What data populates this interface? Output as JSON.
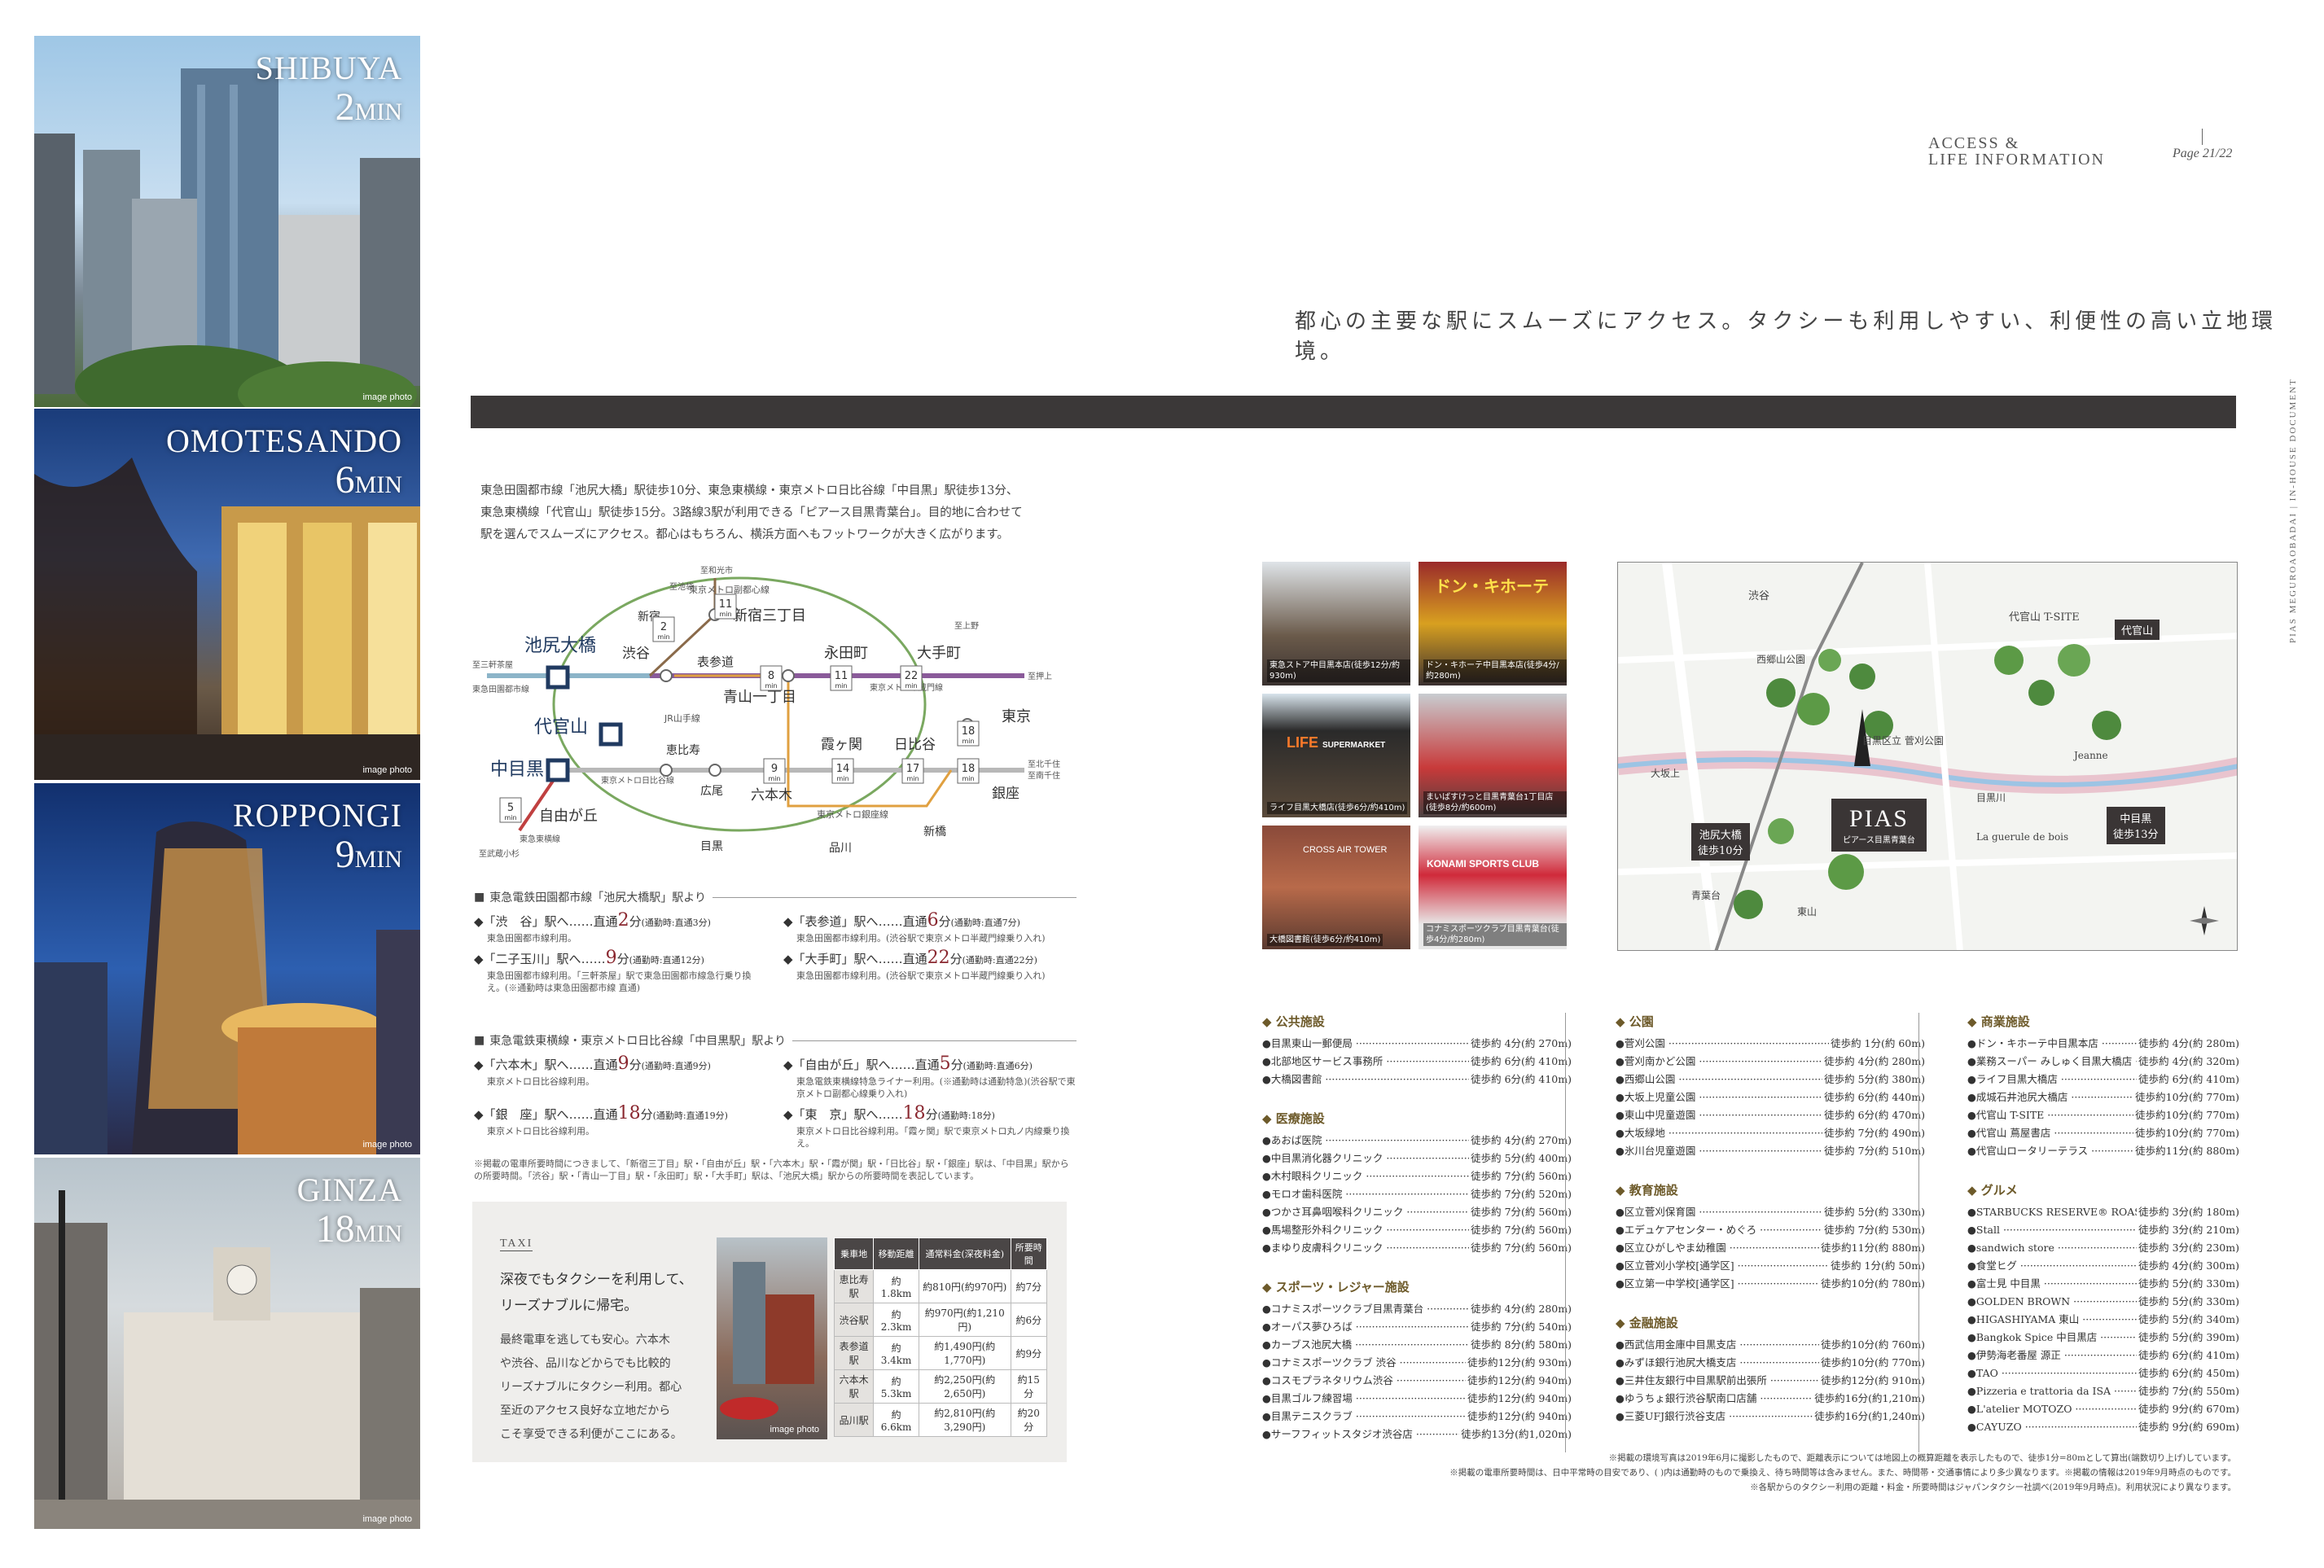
{
  "photos": [
    {
      "name": "SHIBUYA",
      "time": "2",
      "unit": "MIN",
      "note": "image photo"
    },
    {
      "name": "OMOTESANDO",
      "time": "6",
      "unit": "MIN",
      "note": "image photo"
    },
    {
      "name": "ROPPONGI",
      "time": "9",
      "unit": "MIN",
      "note": "image photo"
    },
    {
      "name": "GINZA",
      "time": "18",
      "unit": "MIN",
      "note": "image photo"
    }
  ],
  "header": {
    "line1": "ACCESS &",
    "line2": "LIFE INFORMATION",
    "page": "Page 21/22",
    "side": "PIAS MEGUROAOBADAI | IN-HOUSE DOCUMENT"
  },
  "tagline": "都心の主要な駅にスムーズにアクセス。タクシーも利用しやすい、利便性の高い立地環境。",
  "intro": [
    "東急田園都市線「池尻大橋」駅徒歩10分、東急東横線・東京メトロ日比谷線「中目黒」駅徒歩13分、",
    "東急東横線「代官山」駅徒歩15分。3路線3駅が利用できる「ピアース目黒青葉台」。目的地に合わせて",
    "駅を選んでスムーズにアクセス。都心はもちろん、横浜方面へもフットワークが大きく広がります。"
  ],
  "routemap": {
    "stations": {
      "ikejiri": "池尻大橋",
      "daikanyama": "代官山",
      "nakameguro": "中目黒",
      "shibuya": "渋谷",
      "shinjuku": "新宿",
      "shinjuku3": "新宿三丁目",
      "omotesando": "表参道",
      "aoyama1": "青山一丁目",
      "nagatacho": "永田町",
      "otemachi": "大手町",
      "tokyo": "東京",
      "kasumigaseki": "霞ヶ関",
      "hibiya": "日比谷",
      "ginza": "銀座",
      "roppongi": "六本木",
      "ebisu": "恵比寿",
      "hiroo": "広尾",
      "meguro": "目黒",
      "shinagawa": "品川",
      "shimbashi": "新橋",
      "jiyugaoka": "自由が丘"
    },
    "lines": {
      "denentoshi": "東急田園都市線",
      "fukutoshin": "東京メトロ副都心線",
      "yamanote": "JR山手線",
      "hibiya": "東京メトロ日比谷線",
      "ginzaline": "東京メトロ銀座線",
      "hanzomon": "東京メトロ半蔵門線",
      "toyoko": "東急東横線"
    },
    "mins": [
      "2",
      "11",
      "8",
      "11",
      "22",
      "18",
      "9",
      "14",
      "17",
      "18",
      "5"
    ],
    "min": "min",
    "ends": {
      "sangenjaya": "至三軒茶屋",
      "wako": "至和光市",
      "ikebukuro": "至池袋",
      "oshiage": "至押上",
      "ueno": "至上野",
      "kitasenju": "至北千住",
      "minowa": "至南千住",
      "musashikosugi": "至武蔵小杉"
    }
  },
  "routes1": {
    "title": "東急電鉄田園都市線「池尻大橋駅」駅より",
    "items": [
      {
        "dest": "「渋　谷」駅へ",
        "dots": "……直通",
        "min": "2",
        "unit": "分",
        "note": "(通勤時:直通3分)",
        "sub": "東急田園都市線利用。"
      },
      {
        "dest": "「表参道」駅へ",
        "dots": "……直通",
        "min": "6",
        "unit": "分",
        "note": "(通勤時:直通7分)",
        "sub": "東急田園都市線利用。(渋谷駅で東京メトロ半蔵門線乗り入れ)"
      },
      {
        "dest": "「二子玉川」駅へ",
        "dots": "……",
        "min": "9",
        "unit": "分",
        "note": "(通勤時:直通12分)",
        "sub": "東急田園都市線利用。「三軒茶屋」駅で東急田園都市線急行乗り換え。(※通勤時は東急田園都市線 直通)"
      },
      {
        "dest": "「大手町」駅へ",
        "dots": "……直通",
        "min": "22",
        "unit": "分",
        "note": "(通勤時:直通22分)",
        "sub": "東急田園都市線利用。(渋谷駅で東京メトロ半蔵門線乗り入れ)"
      }
    ]
  },
  "routes2": {
    "title": "東急電鉄東横線・東京メトロ日比谷線「中目黒駅」駅より",
    "items": [
      {
        "dest": "「六本木」駅へ",
        "dots": "……直通",
        "min": "9",
        "unit": "分",
        "note": "(通勤時:直通9分)",
        "sub": "東京メトロ日比谷線利用。"
      },
      {
        "dest": "「自由が丘」駅へ",
        "dots": "……直通",
        "min": "5",
        "unit": "分",
        "note": "(通勤時:直通6分)",
        "sub": "東急電鉄東横線特急ライナー利用。(※通勤時は通勤特急)(渋谷駅で東京メトロ副都心線乗り入れ)"
      },
      {
        "dest": "「銀　座」駅へ",
        "dots": "……直通",
        "min": "18",
        "unit": "分",
        "note": "(通勤時:直通19分)",
        "sub": "東京メトロ日比谷線利用。"
      },
      {
        "dest": "「東　京」駅へ",
        "dots": "……",
        "min": "18",
        "unit": "分",
        "note": "(通勤時:18分)",
        "sub": "東京メトロ日比谷線利用。「霞ヶ関」駅で東京メトロ丸ノ内線乗り換え。"
      }
    ]
  },
  "route_note": "※掲載の電車所要時間につきまして、「新宿三丁目」駅・「自由が丘」駅・「六本木」駅・「霞が関」駅・「日比谷」駅・「銀座」駅は、「中目黒」駅からの所要時間。「渋谷」駅・「青山一丁目」駅・「永田町」駅・「大手町」駅は、「池尻大橋」駅からの所要時間を表記しています。",
  "taxi": {
    "label": "TAXI",
    "heading": [
      "深夜でもタクシーを利用して、",
      "リーズナブルに帰宅。"
    ],
    "body": [
      "最終電車を逃しても安心。六本木",
      "や渋谷、品川などからでも比較的",
      "リーズナブルにタクシー利用。都心",
      "至近のアクセス良好な立地だから",
      "こそ享受できる利便がここにある。"
    ],
    "photo_note": "image photo",
    "table": {
      "headers": [
        "乗車地",
        "移動距離",
        "通常料金(深夜料金)",
        "所要時間"
      ],
      "rows": [
        [
          "恵比寿駅",
          "約1.8km",
          "約810円(約970円)",
          "約7分"
        ],
        [
          "渋谷駅",
          "約2.3km",
          "約970円(約1,210円)",
          "約6分"
        ],
        [
          "表参道駅",
          "約3.4km",
          "約1,490円(約1,770円)",
          "約9分"
        ],
        [
          "六本木駅",
          "約5.3km",
          "約2,250円(約2,650円)",
          "約15分"
        ],
        [
          "品川駅",
          "約6.6km",
          "約2,810円(約3,290円)",
          "約20分"
        ]
      ]
    }
  },
  "thumbs": [
    {
      "cap": "東急ストア中目黒本店(徒歩12分/約930m)"
    },
    {
      "cap": "ドン・キホーテ中目黒本店(徒歩4分/約280m)"
    },
    {
      "cap": "ライフ目黒大橋店(徒歩6分/約410m)"
    },
    {
      "cap": "まいばすけっと目黒青葉台1丁目店(徒歩8分/約600m)"
    },
    {
      "cap": "大橋図書館(徒歩6分/約410m)"
    },
    {
      "cap": "コナミスポーツクラブ目黒青葉台(徒歩4分/約280m)"
    }
  ],
  "thumb_signs": {
    "life": "LIFE",
    "life_sub": "SUPERMARKET",
    "crossair": "CROSS AIR TOWER",
    "konami": "KONAMI SPORTS CLUB",
    "donki": "ドン・キホーテ"
  },
  "map": {
    "pias": "PIAS",
    "pias_sub": "ピアース目黒青葉台",
    "ikejiri": "池尻大橋",
    "ikejiri_walk": "徒歩10分",
    "nakameguro": "中目黒",
    "nakameguro_walk": "徒歩13分",
    "daikanyama": "代官山",
    "labels": [
      "渋谷",
      "代官山 T-SITE",
      "目黒区立 菅刈公園",
      "Jeanne",
      "西郷山公園",
      "大坂上",
      "目黒川",
      "La guerule de bois",
      "東山",
      "青葉台"
    ]
  },
  "facilities": {
    "col1": [
      {
        "cat": "公共施設",
        "items": [
          [
            "目黒東山一郵便局",
            "徒歩約 4分(約 270m)"
          ],
          [
            "北部地区サービス事務所",
            "徒歩約 6分(約 410m)"
          ],
          [
            "大橋図書館",
            "徒歩約 6分(約 410m)"
          ]
        ]
      },
      {
        "cat": "医療施設",
        "items": [
          [
            "あおば医院",
            "徒歩約 4分(約 270m)"
          ],
          [
            "中目黒消化器クリニック",
            "徒歩約 5分(約 400m)"
          ],
          [
            "木村眼科クリニック",
            "徒歩約 7分(約 560m)"
          ],
          [
            "モロオ歯科医院",
            "徒歩約 7分(約 520m)"
          ],
          [
            "つかさ耳鼻咽喉科クリニック",
            "徒歩約 7分(約 560m)"
          ],
          [
            "馬場整形外科クリニック",
            "徒歩約 7分(約 560m)"
          ],
          [
            "まゆり皮膚科クリニック",
            "徒歩約 7分(約 560m)"
          ]
        ]
      },
      {
        "cat": "スポーツ・レジャー施設",
        "items": [
          [
            "コナミスポーツクラブ目黒青葉台",
            "徒歩約 4分(約 280m)"
          ],
          [
            "オーパス夢ひろば",
            "徒歩約 7分(約 540m)"
          ],
          [
            "カーブス池尻大橋",
            "徒歩約 8分(約 580m)"
          ],
          [
            "コナミスポーツクラブ 渋谷",
            "徒歩約12分(約 930m)"
          ],
          [
            "コスモプラネタリウム渋谷",
            "徒歩約12分(約 940m)"
          ],
          [
            "目黒ゴルフ練習場",
            "徒歩約12分(約 940m)"
          ],
          [
            "目黒テニスクラブ",
            "徒歩約12分(約 940m)"
          ],
          [
            "サーフフィットスタジオ渋谷店",
            "徒歩約13分(約1,020m)"
          ]
        ]
      }
    ],
    "col2": [
      {
        "cat": "公園",
        "items": [
          [
            "菅刈公園",
            "徒歩約 1分(約  60m)"
          ],
          [
            "菅刈南かど公園",
            "徒歩約 4分(約 280m)"
          ],
          [
            "西郷山公園",
            "徒歩約 5分(約 380m)"
          ],
          [
            "大坂上児童公園",
            "徒歩約 6分(約 440m)"
          ],
          [
            "東山中児童遊園",
            "徒歩約 6分(約 470m)"
          ],
          [
            "大坂緑地",
            "徒歩約 7分(約 490m)"
          ],
          [
            "氷川台児童遊園",
            "徒歩約 7分(約 510m)"
          ]
        ]
      },
      {
        "cat": "教育施設",
        "items": [
          [
            "区立菅刈保育園",
            "徒歩約 5分(約 330m)"
          ],
          [
            "エデュケアセンター・めぐろ",
            "徒歩約 7分(約 530m)"
          ],
          [
            "区立ひがしやま幼稚園",
            "徒歩約11分(約 880m)"
          ],
          [
            "区立菅刈小学校[通学区]",
            "徒歩約 1分(約  50m)"
          ],
          [
            "区立第一中学校[通学区]",
            "徒歩約10分(約 780m)"
          ]
        ]
      },
      {
        "cat": "金融施設",
        "items": [
          [
            "西武信用金庫中目黒支店",
            "徒歩約10分(約 760m)"
          ],
          [
            "みずほ銀行池尻大橋支店",
            "徒歩約10分(約 770m)"
          ],
          [
            "三井住友銀行中目黒駅前出張所",
            "徒歩約12分(約 910m)"
          ],
          [
            "ゆうちょ銀行渋谷駅南口店舗",
            "徒歩約16分(約1,210m)"
          ],
          [
            "三菱UFJ銀行渋谷支店",
            "徒歩約16分(約1,240m)"
          ]
        ]
      }
    ],
    "col3": [
      {
        "cat": "商業施設",
        "items": [
          [
            "ドン・キホーテ中目黒本店",
            "徒歩約 4分(約 280m)"
          ],
          [
            "業務スーパー みしゅく目黒大橋店",
            "徒歩約 4分(約 320m)"
          ],
          [
            "ライフ目黒大橋店",
            "徒歩約 6分(約 410m)"
          ],
          [
            "成城石井池尻大橋店",
            "徒歩約10分(約 770m)"
          ],
          [
            "代官山 T-SITE",
            "徒歩約10分(約 770m)"
          ],
          [
            "代官山 蔦屋書店",
            "徒歩約10分(約 770m)"
          ],
          [
            "代官山ロータリーテラス",
            "徒歩約11分(約 880m)"
          ]
        ]
      },
      {
        "cat": "グルメ",
        "items": [
          [
            "STARBUCKS RESERVE® ROASTERY TOKYO",
            "徒歩約 3分(約 180m)"
          ],
          [
            "Stall",
            "徒歩約 3分(約 210m)"
          ],
          [
            "sandwich store",
            "徒歩約 3分(約 230m)"
          ],
          [
            "食堂ヒグ",
            "徒歩約 4分(約 300m)"
          ],
          [
            "富士見 中目黒",
            "徒歩約 5分(約 330m)"
          ],
          [
            "GOLDEN BROWN",
            "徒歩約 5分(約 330m)"
          ],
          [
            "HIGASHIYAMA 東山",
            "徒歩約 5分(約 340m)"
          ],
          [
            "Bangkok Spice 中目黒店",
            "徒歩約 5分(約 390m)"
          ],
          [
            "伊勢海老番屋 源正",
            "徒歩約 6分(約 410m)"
          ],
          [
            "TAO",
            "徒歩約 6分(約 450m)"
          ],
          [
            "Pizzeria e trattoria da ISA",
            "徒歩約 7分(約 550m)"
          ],
          [
            "L'atelier MOTOZO",
            "徒歩約 9分(約 670m)"
          ],
          [
            "CAYUZO",
            "徒歩約 9分(約 690m)"
          ]
        ]
      }
    ]
  },
  "footnotes": [
    "※掲載の環境写真は2019年6月に撮影したもので、距離表示については地図上の概算距離を表示したもので、徒歩1分=80mとして算出(端数切り上げ)しています。",
    "※掲載の電車所要時間は、日中平常時の目安であり、( )内は通勤時のもので乗換え、待ち時間等は含みません。また、時間帯・交通事情により多少異なります。※掲載の情報は2019年9月時点のものです。",
    "※各駅からのタクシー利用の距離・料金・所要時間はジャパンタクシー社調べ(2019年9月時点)。利用状況により異なります。"
  ]
}
